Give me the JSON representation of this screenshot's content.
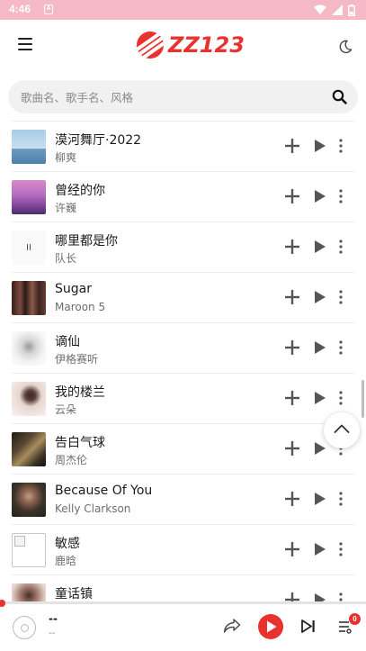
{
  "status_bar": {
    "time": "4:46",
    "notification_icon": "a-icon",
    "right_icons": [
      "wifi-icon",
      "signal-icon",
      "battery-icon"
    ]
  },
  "header": {
    "logo_text": "ZZ123",
    "menu_icon": "hamburger-icon",
    "theme_icon": "moon-icon"
  },
  "search": {
    "placeholder": "歌曲名、歌手名、风格",
    "icon": "search-icon"
  },
  "songs": [
    {
      "title": "漠河舞厅·2022",
      "artist": "柳爽"
    },
    {
      "title": "曾经的你",
      "artist": "许巍"
    },
    {
      "title": "哪里都是你",
      "artist": "队长"
    },
    {
      "title": "Sugar",
      "artist": "Maroon 5"
    },
    {
      "title": "谪仙",
      "artist": "伊格赛听"
    },
    {
      "title": "我的楼兰",
      "artist": "云朵"
    },
    {
      "title": "告白气球",
      "artist": "周杰伦"
    },
    {
      "title": "Because Of You",
      "artist": "Kelly Clarkson"
    },
    {
      "title": "敏感",
      "artist": "鹿晗"
    },
    {
      "title": "童话镇",
      "artist": ""
    }
  ],
  "player": {
    "title": "--",
    "artist": "--",
    "queue_count": "0",
    "progress": 0
  },
  "colors": {
    "accent": "#e8322e",
    "status_bar": "#f4b9c4"
  }
}
